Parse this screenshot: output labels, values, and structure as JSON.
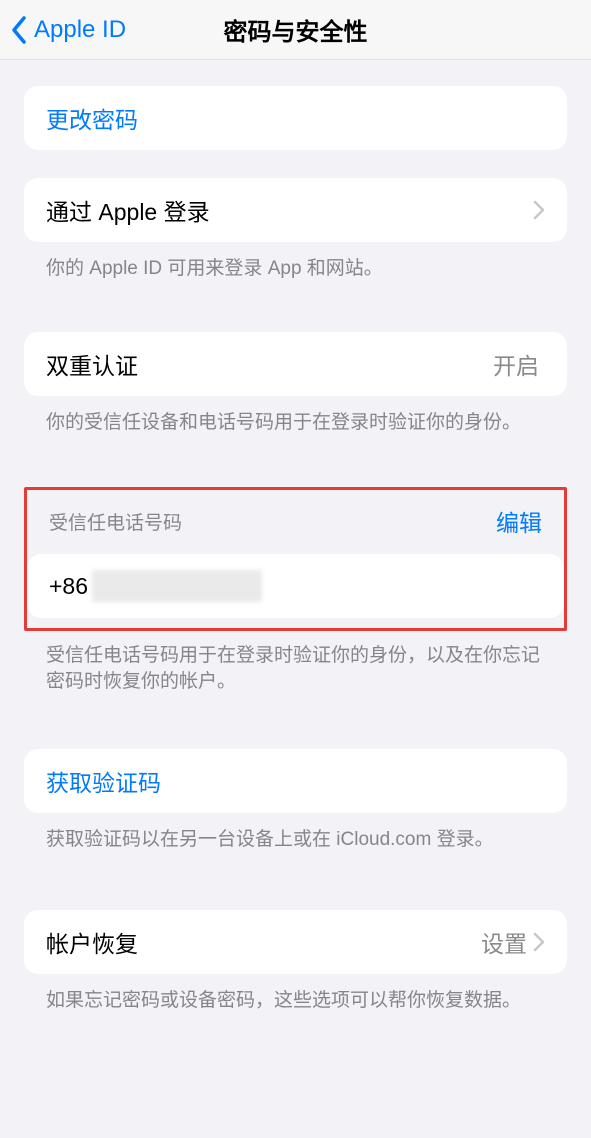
{
  "nav": {
    "back_label": "Apple ID",
    "title": "密码与安全性"
  },
  "change_password": {
    "label": "更改密码"
  },
  "sign_in_with_apple": {
    "label": "通过 Apple 登录",
    "note": "你的 Apple ID 可用来登录 App 和网站。"
  },
  "two_factor": {
    "label": "双重认证",
    "value": "开启",
    "note": "你的受信任设备和电话号码用于在登录时验证你的身份。"
  },
  "trusted_phone": {
    "header": "受信任电话号码",
    "edit": "编辑",
    "number_prefix": "+86",
    "note": "受信任电话号码用于在登录时验证你的身份，以及在你忘记密码时恢复你的帐户。"
  },
  "get_code": {
    "label": "获取验证码",
    "note": "获取验证码以在另一台设备上或在 iCloud.com 登录。"
  },
  "account_recovery": {
    "label": "帐户恢复",
    "value": "设置",
    "note": "如果忘记密码或设备密码，这些选项可以帮你恢复数据。"
  }
}
